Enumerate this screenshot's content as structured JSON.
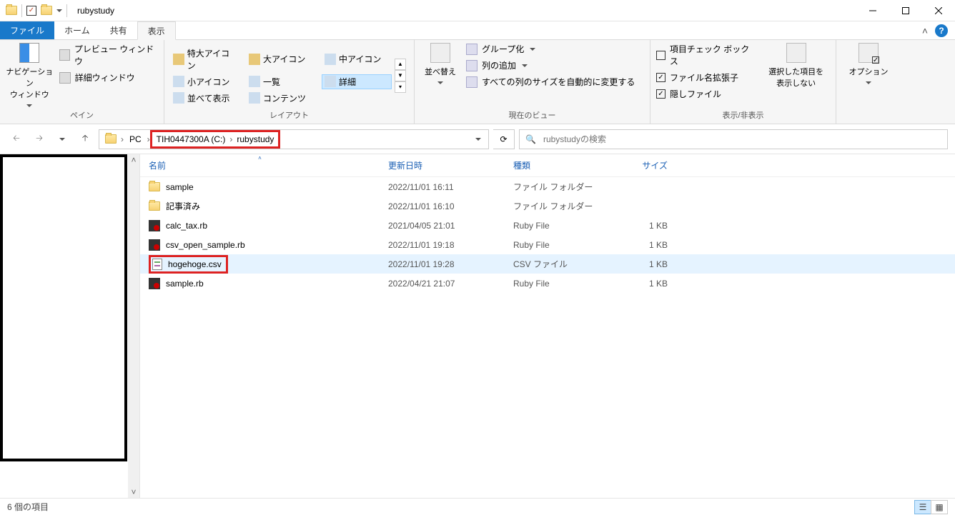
{
  "window": {
    "title": "rubystudy"
  },
  "tabs": {
    "file": "ファイル",
    "home": "ホーム",
    "share": "共有",
    "view": "表示"
  },
  "ribbon": {
    "pane": {
      "nav": "ナビゲーション\nウィンドウ",
      "preview": "プレビュー ウィンドウ",
      "details": "詳細ウィンドウ",
      "label": "ペイン"
    },
    "layout": {
      "xl": "特大アイコン",
      "l": "大アイコン",
      "m": "中アイコン",
      "s": "小アイコン",
      "list": "一覧",
      "details": "詳細",
      "tiles": "並べて表示",
      "content": "コンテンツ",
      "label": "レイアウト"
    },
    "view": {
      "sort": "並べ替え",
      "group": "グループ化",
      "addcol": "列の追加",
      "autosize": "すべての列のサイズを自動的に変更する",
      "label": "現在のビュー"
    },
    "showhide": {
      "checkboxes": "項目チェック ボックス",
      "ext": "ファイル名拡張子",
      "hidden": "隠しファイル",
      "hidesel": "選択した項目を\n表示しない",
      "label": "表示/非表示"
    },
    "options": "オプション"
  },
  "breadcrumb": {
    "pc": "PC",
    "drive": "TIH0447300A (C:)",
    "folder": "rubystudy"
  },
  "search": {
    "placeholder": "rubystudyの検索"
  },
  "columns": {
    "name": "名前",
    "date": "更新日時",
    "type": "種類",
    "size": "サイズ"
  },
  "files": [
    {
      "icon": "folder",
      "name": "sample",
      "date": "2022/11/01 16:11",
      "type": "ファイル フォルダー",
      "size": ""
    },
    {
      "icon": "folder",
      "name": "記事済み",
      "date": "2022/11/01 16:10",
      "type": "ファイル フォルダー",
      "size": ""
    },
    {
      "icon": "rb",
      "name": "calc_tax.rb",
      "date": "2021/04/05 21:01",
      "type": "Ruby File",
      "size": "1 KB"
    },
    {
      "icon": "rb",
      "name": "csv_open_sample.rb",
      "date": "2022/11/01 19:18",
      "type": "Ruby File",
      "size": "1 KB"
    },
    {
      "icon": "csv",
      "name": "hogehoge.csv",
      "date": "2022/11/01 19:28",
      "type": "CSV ファイル",
      "size": "1 KB",
      "highlight": true,
      "hover": true
    },
    {
      "icon": "rb",
      "name": "sample.rb",
      "date": "2022/04/21 21:07",
      "type": "Ruby File",
      "size": "1 KB"
    }
  ],
  "status": {
    "count": "6 個の項目"
  }
}
